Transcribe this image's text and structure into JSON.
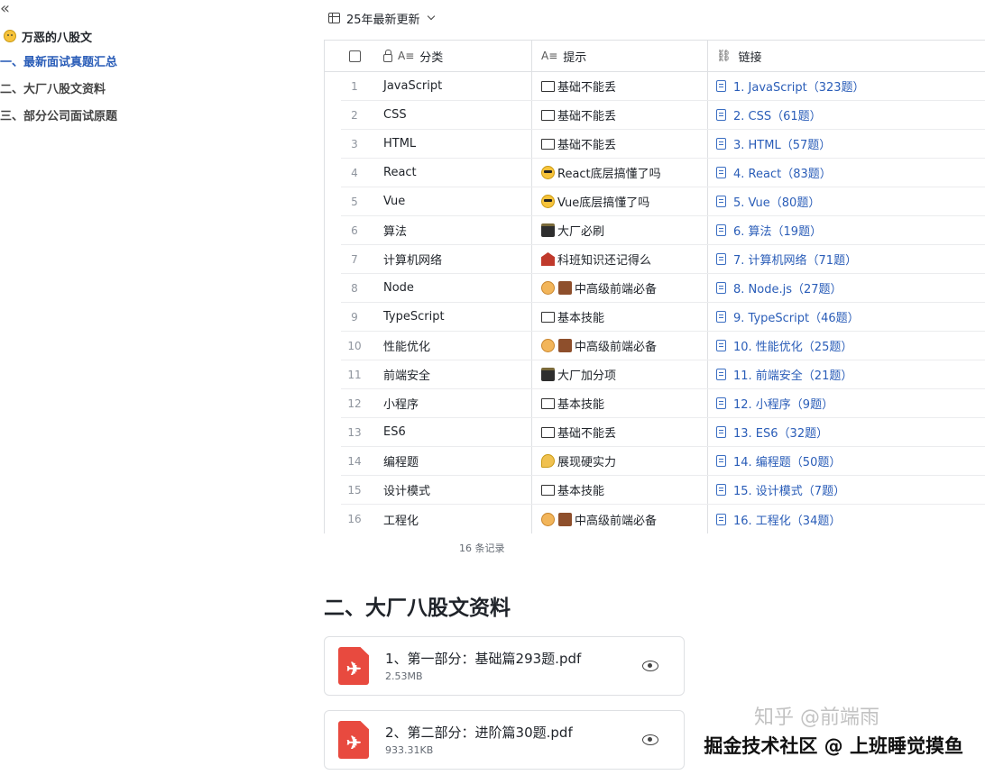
{
  "sidebar": {
    "collapse_glyph": "«",
    "title": "万恶的八股文",
    "items": [
      {
        "label": "一、最新面试真题汇总",
        "active": true
      },
      {
        "label": "二、大厂八股文资料",
        "active": false
      },
      {
        "label": "三、部分公司面试原题",
        "active": false
      }
    ]
  },
  "view": {
    "name": "25年最新更新"
  },
  "table": {
    "headers": {
      "category": "分类",
      "tip": "提示",
      "link": "链接"
    },
    "rows": [
      {
        "idx": "1",
        "category": "JavaScript",
        "tip_icon": "box",
        "tip": "基础不能丢",
        "link": "1. JavaScript（323题）"
      },
      {
        "idx": "2",
        "category": "CSS",
        "tip_icon": "box",
        "tip": "基础不能丢",
        "link": "2. CSS（61题）"
      },
      {
        "idx": "3",
        "category": "HTML",
        "tip_icon": "box",
        "tip": "基础不能丢",
        "link": "3. HTML（57题）"
      },
      {
        "idx": "4",
        "category": "React",
        "tip_icon": "cool",
        "tip": "React底层搞懂了吗",
        "link": "4. React（83题）"
      },
      {
        "idx": "5",
        "category": "Vue",
        "tip_icon": "cool",
        "tip": "Vue底层搞懂了吗",
        "link": "5. Vue（80题）"
      },
      {
        "idx": "6",
        "category": "算法",
        "tip_icon": "cube",
        "tip": "大厂必刷",
        "link": "6. 算法（19题）"
      },
      {
        "idx": "7",
        "category": "计算机网络",
        "tip_icon": "school",
        "tip": "科班知识还记得么",
        "link": "7. 计算机网络（71题）"
      },
      {
        "idx": "8",
        "category": "Node",
        "tip_icon": "worker",
        "tip": "中高级前端必备",
        "link": "8. Node.js（27题）"
      },
      {
        "idx": "9",
        "category": "TypeScript",
        "tip_icon": "box",
        "tip": "基本技能",
        "link": "9. TypeScript（46题）"
      },
      {
        "idx": "10",
        "category": "性能优化",
        "tip_icon": "worker",
        "tip": "中高级前端必备",
        "link": "10. 性能优化（25题）"
      },
      {
        "idx": "11",
        "category": "前端安全",
        "tip_icon": "cube",
        "tip": "大厂加分项",
        "link": "11. 前端安全（21题）"
      },
      {
        "idx": "12",
        "category": "小程序",
        "tip_icon": "box",
        "tip": "基本技能",
        "link": "12. 小程序（9题）"
      },
      {
        "idx": "13",
        "category": "ES6",
        "tip_icon": "box",
        "tip": "基础不能丢",
        "link": "13. ES6（32题）"
      },
      {
        "idx": "14",
        "category": "编程题",
        "tip_icon": "arm",
        "tip": "展现硬实力",
        "link": "14. 编程题（50题）"
      },
      {
        "idx": "15",
        "category": "设计模式",
        "tip_icon": "box",
        "tip": "基本技能",
        "link": "15. 设计模式（7题）"
      },
      {
        "idx": "16",
        "category": "工程化",
        "tip_icon": "worker",
        "tip": "中高级前端必备",
        "link": "16. 工程化（34题）"
      }
    ],
    "record_count": "16 条记录"
  },
  "section2": {
    "title": "二、大厂八股文资料",
    "files": [
      {
        "name": "1、第一部分：基础篇293题.pdf",
        "size": "2.53MB"
      },
      {
        "name": "2、第二部分：进阶篇30题.pdf",
        "size": "933.31KB"
      }
    ]
  },
  "watermark": {
    "faint": "知乎 @前端雨",
    "main": "掘金技术社区 @ 上班睡觉摸鱼"
  },
  "colors": {
    "accent": "#2a5db8",
    "pdf": "#e84a3f",
    "border": "#dee0e3"
  }
}
